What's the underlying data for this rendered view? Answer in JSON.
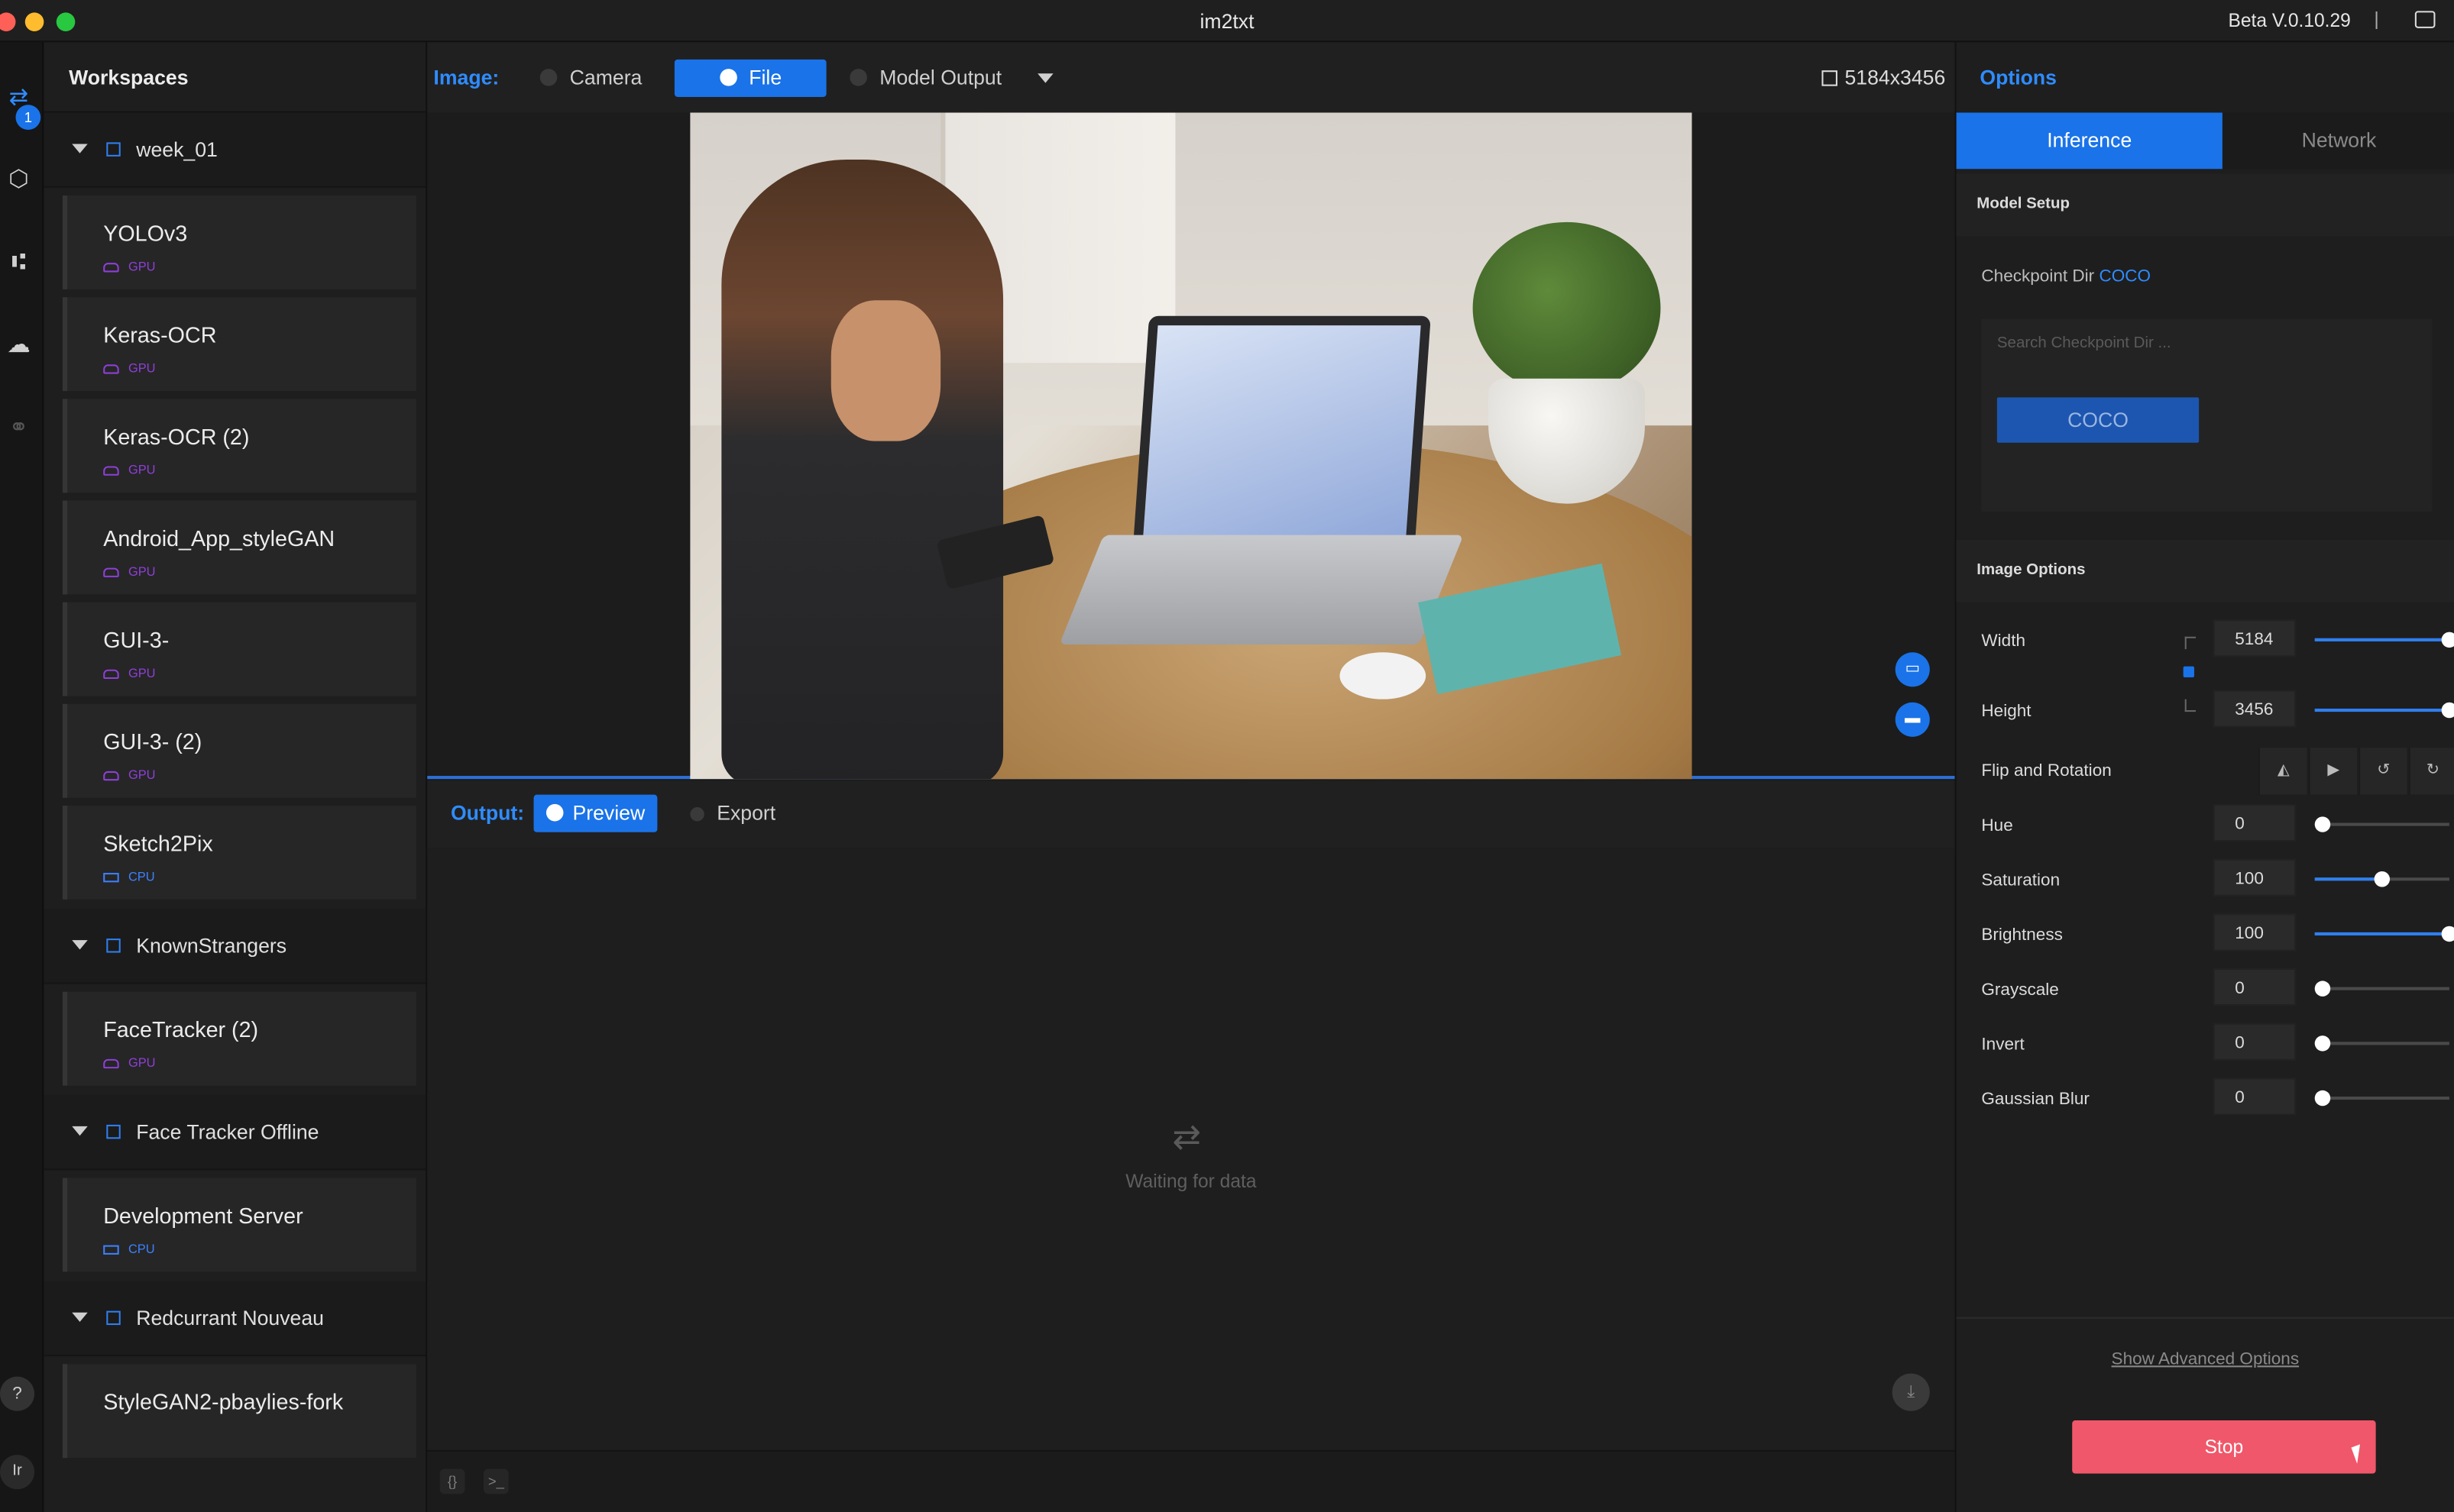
{
  "window": {
    "title": "im2txt",
    "version": "Beta V.0.10.29",
    "version_sep": "|"
  },
  "iconbar": {
    "badge": "1",
    "help": "?",
    "user": "Ir"
  },
  "sidebar": {
    "title": "Workspaces",
    "groups": [
      {
        "label": "week_01",
        "items": [
          {
            "name": "YOLOv3",
            "hw": "GPU"
          },
          {
            "name": "Keras-OCR",
            "hw": "GPU"
          },
          {
            "name": "Keras-OCR (2)",
            "hw": "GPU"
          },
          {
            "name": "Android_App_styleGAN",
            "hw": "GPU"
          },
          {
            "name": "GUI-3-",
            "hw": "GPU"
          },
          {
            "name": "GUI-3- (2)",
            "hw": "GPU"
          },
          {
            "name": "Sketch2Pix",
            "hw": "CPU"
          }
        ]
      },
      {
        "label": "KnownStrangers",
        "items": [
          {
            "name": "FaceTracker (2)",
            "hw": "GPU"
          }
        ]
      },
      {
        "label": "Face Tracker Offline",
        "items": [
          {
            "name": "Development Server",
            "hw": "CPU"
          }
        ]
      },
      {
        "label": "Redcurrant Nouveau",
        "items": [
          {
            "name": "StyleGAN2-pbaylies-fork",
            "hw": ""
          }
        ]
      }
    ]
  },
  "image_bar": {
    "label": "Image:",
    "camera": "Camera",
    "file": "File",
    "model_output": "Model Output",
    "resolution": "5184x3456"
  },
  "output_bar": {
    "label": "Output:",
    "preview": "Preview",
    "export": "Export"
  },
  "output": {
    "waiting": "Waiting for data"
  },
  "options": {
    "title": "Options",
    "tabs": {
      "inference": "Inference",
      "network": "Network"
    },
    "model_setup": "Model Setup",
    "checkpoint_label": "Checkpoint Dir",
    "checkpoint_value": "COCO",
    "checkpoint_search_placeholder": "Search Checkpoint Dir ...",
    "checkpoint_option": "COCO",
    "image_options": "Image Options",
    "width_label": "Width",
    "width_value": "5184",
    "width_level": 1.0,
    "height_label": "Height",
    "height_value": "3456",
    "height_level": 1.0,
    "flip_label": "Flip and Rotation",
    "hue_label": "Hue",
    "hue_value": "0",
    "hue_level": 0.0,
    "saturation_label": "Saturation",
    "saturation_value": "100",
    "saturation_level": 0.5,
    "brightness_label": "Brightness",
    "brightness_value": "100",
    "brightness_level": 1.0,
    "grayscale_label": "Grayscale",
    "grayscale_value": "0",
    "grayscale_level": 0.0,
    "invert_label": "Invert",
    "invert_value": "0",
    "invert_level": 0.0,
    "blur_label": "Gaussian Blur",
    "blur_value": "0",
    "blur_level": 0.0,
    "advanced": "Show Advanced Options",
    "stop": "Stop"
  },
  "colors": {
    "accent": "#1a73e8",
    "stop": "#f0576a",
    "gpu": "#8e3fd8",
    "cpu": "#3d80ff"
  }
}
